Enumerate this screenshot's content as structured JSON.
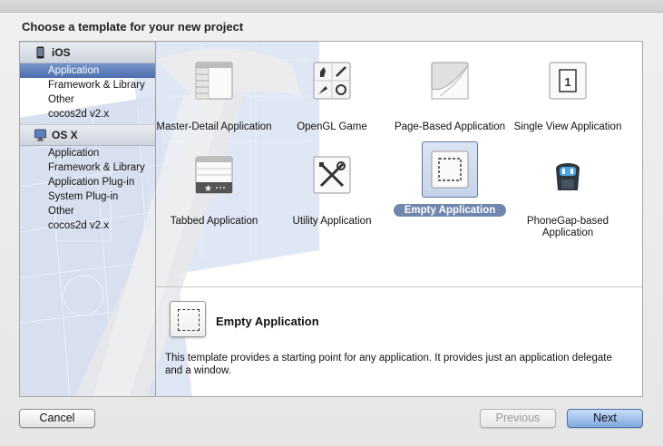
{
  "dialog": {
    "heading": "Choose a template for your new project"
  },
  "sidebar": {
    "sections": [
      {
        "title": "iOS",
        "icon": "iphone-icon",
        "items": [
          {
            "label": "Application",
            "selected": true
          },
          {
            "label": "Framework & Library",
            "selected": false
          },
          {
            "label": "Other",
            "selected": false
          },
          {
            "label": "cocos2d v2.x",
            "selected": false
          }
        ]
      },
      {
        "title": "OS X",
        "icon": "mac-icon",
        "items": [
          {
            "label": "Application",
            "selected": false
          },
          {
            "label": "Framework & Library",
            "selected": false
          },
          {
            "label": "Application Plug-in",
            "selected": false
          },
          {
            "label": "System Plug-in",
            "selected": false
          },
          {
            "label": "Other",
            "selected": false
          },
          {
            "label": "cocos2d v2.x",
            "selected": false
          }
        ]
      }
    ]
  },
  "templates": [
    {
      "label": "Master-Detail Application",
      "icon": "master-detail-icon",
      "selected": false
    },
    {
      "label": "OpenGL Game",
      "icon": "opengl-game-icon",
      "selected": false
    },
    {
      "label": "Page-Based Application",
      "icon": "page-curl-icon",
      "selected": false
    },
    {
      "label": "Single View Application",
      "icon": "single-view-icon",
      "icon_text": "1",
      "selected": false
    },
    {
      "label": "Tabbed Application",
      "icon": "tab-bar-icon",
      "selected": false
    },
    {
      "label": "Utility Application",
      "icon": "tools-icon",
      "selected": false
    },
    {
      "label": "Empty Application",
      "icon": "empty-dashed-icon",
      "selected": true
    },
    {
      "label": "PhoneGap-based Application",
      "icon": "phonegap-icon",
      "selected": false
    }
  ],
  "detail": {
    "title": "Empty Application",
    "description": "This template provides a starting point for any application. It provides just an application delegate and a window."
  },
  "buttons": {
    "cancel": "Cancel",
    "previous": "Previous",
    "next": "Next"
  },
  "colors": {
    "selection": "#5774ad",
    "blueprint": "#3f63b5",
    "default_button": "#7fa8e0"
  }
}
